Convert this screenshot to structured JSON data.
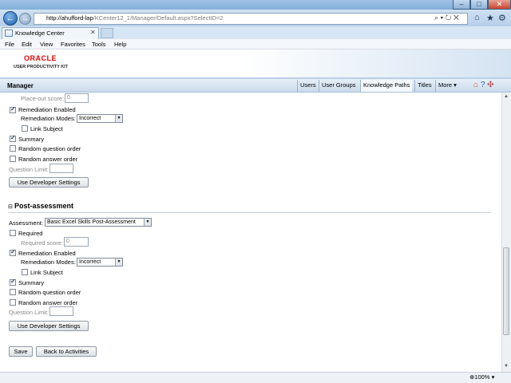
{
  "browser": {
    "url_host": "http://ahufford-lap",
    "url_path": "/KCenter12_1/Manager/Default.aspx?SelectID=2",
    "tab_title": "Knowledge Center",
    "zoom": "100%",
    "menu": [
      "File",
      "Edit",
      "View",
      "Favorites",
      "Tools",
      "Help"
    ]
  },
  "header": {
    "logo_main": "ORACLE",
    "logo_sub": "USER PRODUCTIVITY KIT"
  },
  "managerbar": {
    "title": "Manager",
    "tabs": [
      "Users",
      "User Groups",
      "Knowledge Paths",
      "Titles",
      "More ▾"
    ]
  },
  "pre": {
    "placeout_label": "Place-out score:",
    "placeout_value": "0",
    "remediation_label": "Remediation Enabled",
    "modes_label": "Remediation Modes:",
    "modes_value": "Incorrect",
    "link_subject_label": "Link Subject",
    "summary_label": "Summary",
    "random_q_label": "Random question order",
    "random_a_label": "Random answer order",
    "qlimit_label": "Question Limit:",
    "dev_button": "Use Developer Settings"
  },
  "post": {
    "section_title": "Post-assessment",
    "assessment_label": "Assessment:",
    "assessment_value": "Basic Excel Skills Post-Assessment",
    "required_label": "Required",
    "req_score_label": "Required score:",
    "req_score_value": "0",
    "remediation_label": "Remediation Enabled",
    "modes_label": "Remediation Modes:",
    "modes_value": "Incorrect",
    "link_subject_label": "Link Subject",
    "summary_label": "Summary",
    "random_q_label": "Random question order",
    "random_a_label": "Random answer order",
    "qlimit_label": "Question Limit:",
    "dev_button": "Use Developer Settings"
  },
  "actions": {
    "save": "Save",
    "back": "Back to Activities"
  }
}
